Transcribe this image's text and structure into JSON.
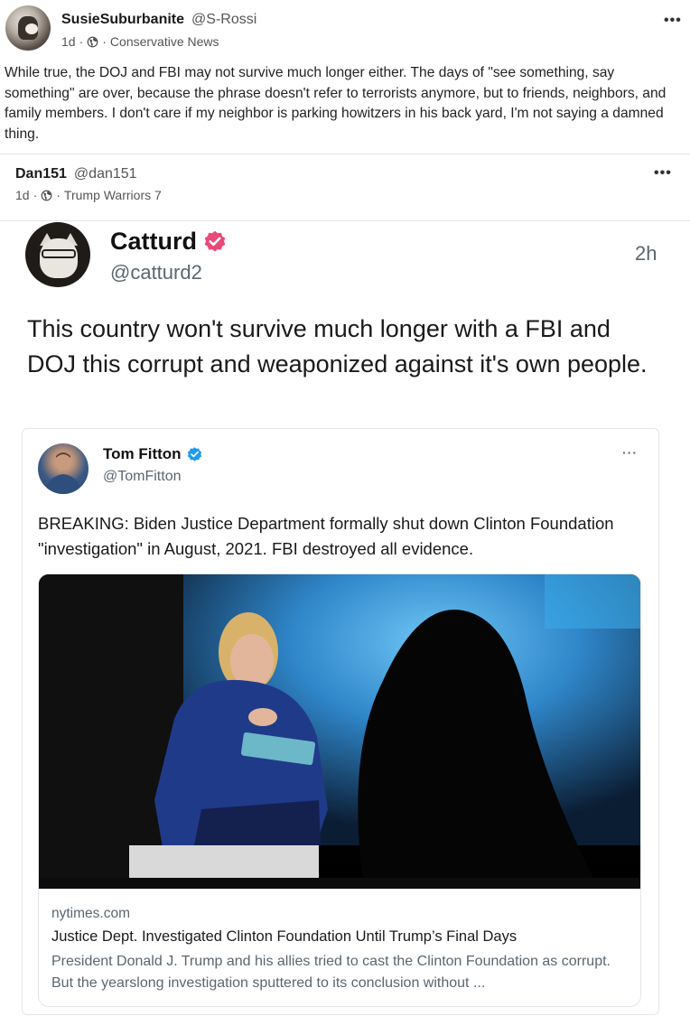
{
  "post": {
    "author_name": "SusieSuburbanite",
    "author_handle": "@S-Rossi",
    "age": "1d",
    "separator": "·",
    "community": "Conservative News",
    "more_label": "•••",
    "text": "While true, the DOJ and FBI may not survive much longer either. The days of \"see something, say something\" are over, because the phrase doesn't refer to terrorists anymore, but to friends, neighbors, and family members. I don't care if my neighbor is parking howitzers in his back yard, I'm not saying a damned thing."
  },
  "shared": {
    "author_name": "Dan151",
    "author_handle": "@dan151",
    "age": "1d",
    "separator": "·",
    "community": "Trump Warriors 7",
    "more_label": "•••"
  },
  "screenshot": {
    "name": "Catturd",
    "handle": "@catturd2",
    "time": "2h",
    "text": "This country won't survive much longer with a FBI and DOJ this corrupt and weaponized against it's own people.",
    "verified_color": "#e94a79",
    "quoted": {
      "name": "Tom Fitton",
      "handle": "@TomFitton",
      "more_label": "···",
      "verified_color": "#1d9bf0",
      "text": "BREAKING: Biden Justice Department formally shut down Clinton Foundation \"investigation\" in August, 2021. FBI destroyed all evidence.",
      "link": {
        "domain": "nytimes.com",
        "title": "Justice Dept. Investigated Clinton Foundation Until Trump’s Final Days",
        "description": "President Donald J. Trump and his allies tried to cast the Clinton Foundation as corrupt. But the yearslong investigation sputtered to its conclusion without ..."
      }
    }
  },
  "icons": {
    "globe": "globe-icon",
    "more": "more-options-icon",
    "verified": "verified-badge-icon"
  }
}
